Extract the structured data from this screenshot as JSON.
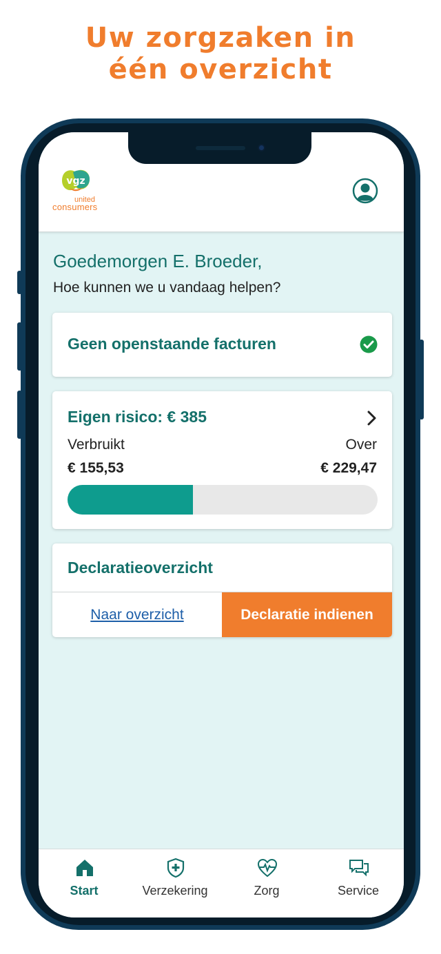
{
  "headline": {
    "line1": "Uw zorgzaken in",
    "line2": "één overzicht"
  },
  "logo": {
    "mark": "vgz",
    "word1": "united",
    "word2": "consumers"
  },
  "header": {
    "profile_icon": "user-circle-icon"
  },
  "greeting": {
    "title": "Goedemorgen E. Broeder,",
    "subtitle": "Hoe kunnen we u vandaag helpen?"
  },
  "invoices_card": {
    "title": "Geen openstaande facturen",
    "status_icon": "check-circle-icon",
    "status_color": "#1a9a4a"
  },
  "deductible_card": {
    "title": "Eigen risico: € 385",
    "used_label": "Verbruikt",
    "remaining_label": "Over",
    "used_value": "€ 155,53",
    "remaining_value": "€ 229,47",
    "progress_fraction": 0.404,
    "progress_color": "#0e9c8e",
    "chevron_icon": "chevron-right-icon"
  },
  "claims_card": {
    "title": "Declaratieoverzicht",
    "overview_link": "Naar overzicht",
    "submit_button": "Declaratie indienen",
    "accent_color": "#f07d2d"
  },
  "bottom_nav": {
    "items": [
      {
        "label": "Start",
        "icon": "home-icon",
        "active": true
      },
      {
        "label": "Verzekering",
        "icon": "shield-plus-icon",
        "active": false
      },
      {
        "label": "Zorg",
        "icon": "heartbeat-icon",
        "active": false
      },
      {
        "label": "Service",
        "icon": "chat-bubbles-icon",
        "active": false
      }
    ]
  },
  "colors": {
    "brand_teal": "#14706a",
    "brand_orange": "#f07d2d",
    "screen_background": "#e2f4f4",
    "phone_frame": "#0f3a57"
  }
}
